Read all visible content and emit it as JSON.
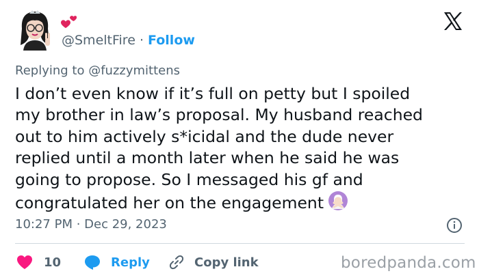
{
  "header": {
    "handle": "@SmeltFire",
    "separator": " · ",
    "follow_label": "Follow"
  },
  "replying_to": "Replying to @fuzzymittens",
  "tweet": {
    "lines": [
      "I don’t even know if it’s full on petty but I spoiled",
      "my brother in law’s proposal. My husband reached",
      "out to him actively s*icidal and the dude never",
      "replied until a month later when he said he was",
      "going to propose. So I messaged his gf and",
      "congratulated her on the engagement"
    ],
    "emoji": "person-gesturing-no-emoji"
  },
  "timestamp": "10:27 PM · Dec 29, 2023",
  "actions": {
    "like_count": "10",
    "reply_label": "Reply",
    "copy_link_label": "Copy link"
  },
  "watermark": "boredpanda.com",
  "colors": {
    "link_blue": "#1d9bf0",
    "like_pink": "#f91880",
    "secondary_text": "#536471",
    "primary_text": "#0f1419"
  },
  "icons": [
    "heart-icon",
    "reply-bubble-icon",
    "link-icon",
    "info-icon",
    "x-logo-icon",
    "hearts-emoji"
  ]
}
